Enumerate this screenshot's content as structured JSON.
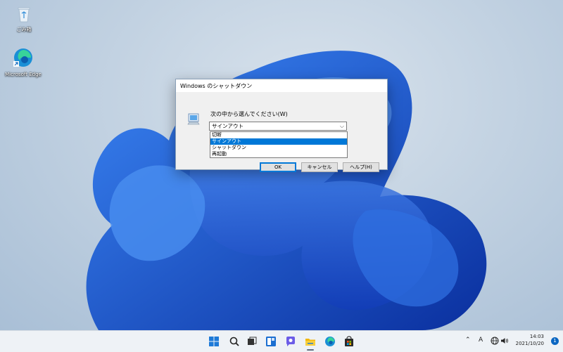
{
  "desktop": {
    "icons": [
      {
        "label": "ごみ箱",
        "icon": "recycle-bin-icon"
      },
      {
        "label": "Microsoft Edge",
        "icon": "edge-icon"
      }
    ]
  },
  "dialog": {
    "title": "Windows のシャットダウン",
    "prompt": "次の中から選んでください(W)",
    "selected": "サインアウト",
    "options": [
      "切断",
      "サインアウト",
      "シャットダウン",
      "再起動"
    ],
    "selected_index": 1,
    "buttons": {
      "ok": "OK",
      "cancel": "キャンセル",
      "help": "ヘルプ(H)"
    }
  },
  "taskbar": {
    "icons": [
      "start-icon",
      "search-icon",
      "task-view-icon",
      "widgets-icon",
      "chat-icon",
      "file-explorer-icon",
      "edge-icon",
      "store-icon"
    ],
    "tray": {
      "ime": "A",
      "time": "14:03",
      "date": "2021/10/20",
      "notifications": "1"
    }
  },
  "colors": {
    "accent": "#0078d7",
    "wallpaper": "#1f5fd8"
  }
}
